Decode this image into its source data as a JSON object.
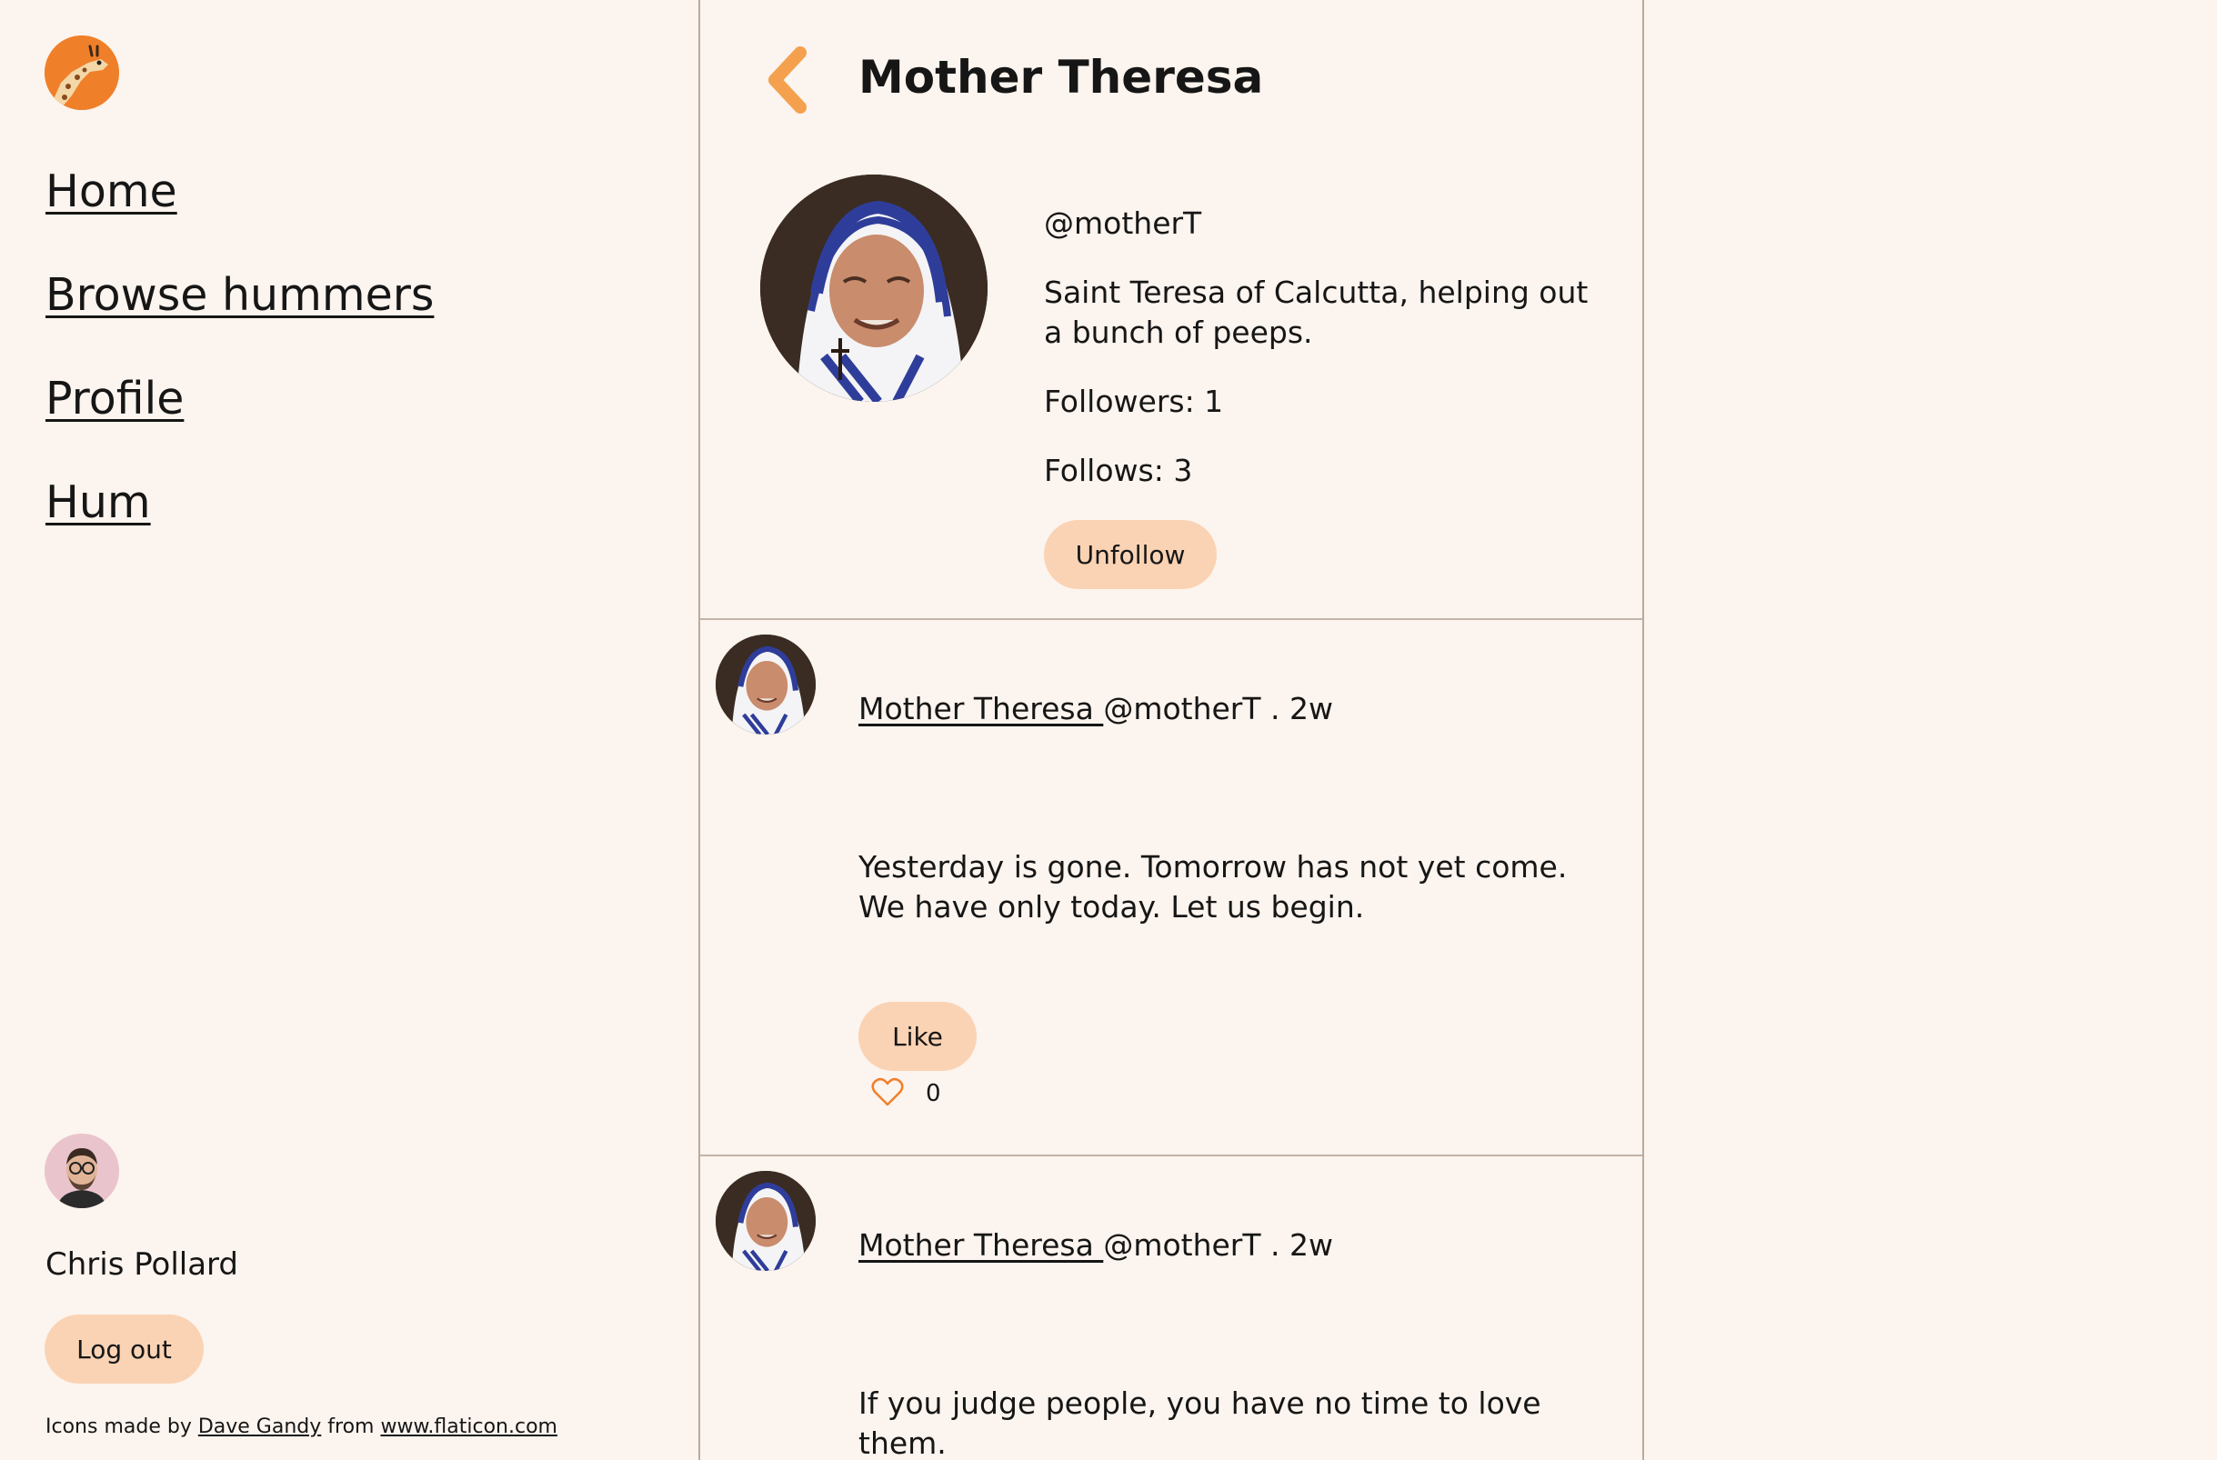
{
  "sidebar": {
    "logo_icon": "giraffe-logo-icon",
    "nav": [
      {
        "label": "Home"
      },
      {
        "label": "Browse hummers"
      },
      {
        "label": "Profile"
      },
      {
        "label": "Hum"
      }
    ],
    "user": {
      "avatar_icon": "user-avatar",
      "name": "Chris Pollard",
      "logout_label": "Log out"
    },
    "credits": {
      "prefix": "Icons made by ",
      "author": "Dave Gandy",
      "middle": " from ",
      "site": "www.flaticon.com"
    }
  },
  "profile": {
    "back_icon": "chevron-left-icon",
    "title": "Mother Theresa",
    "handle": "@motherT",
    "bio": "Saint Teresa of Calcutta, helping out a bunch of peeps.",
    "followers": "Followers: 1",
    "follows": "Follows: 3",
    "unfollow_label": "Unfollow"
  },
  "posts": [
    {
      "author": "Mother Theresa ",
      "handle_time": "@motherT . 2w",
      "text": "Yesterday is gone. Tomorrow has not yet come. We have only today. Let us begin.",
      "like_label": "Like",
      "likes": "0"
    },
    {
      "author": "Mother Theresa ",
      "handle_time": "@motherT . 2w",
      "text": "If you judge people, you have no time to love them."
    }
  ],
  "colors": {
    "background": "#fcf4ee",
    "button": "#fad3b4",
    "accent": "#f4a04f",
    "divider": "#c2b4a8"
  }
}
